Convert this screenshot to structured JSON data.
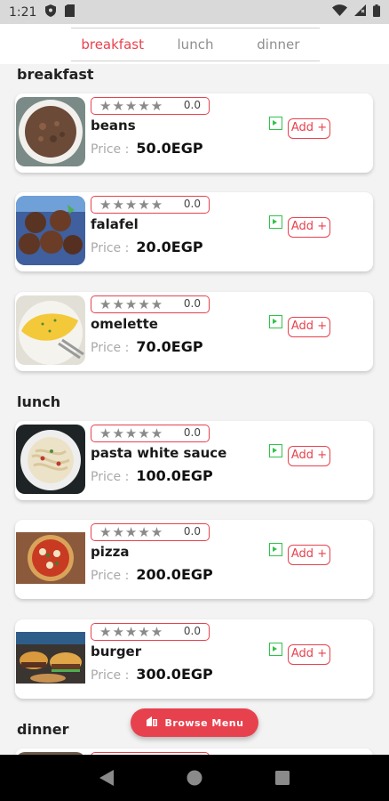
{
  "status_bar": {
    "time": "1:21"
  },
  "tabs": [
    {
      "label": "breakfast",
      "active": true
    },
    {
      "label": "lunch",
      "active": false
    },
    {
      "label": "dinner",
      "active": false
    }
  ],
  "sections": {
    "breakfast": "breakfast",
    "lunch": "lunch",
    "dinner": "dinner"
  },
  "common": {
    "price_label": "Price :",
    "add_label": "Add +",
    "stars": "★★★★★"
  },
  "items": [
    {
      "name": "beans",
      "rating": "0.0",
      "price": "50.0EGP"
    },
    {
      "name": "falafel",
      "rating": "0.0",
      "price": "20.0EGP"
    },
    {
      "name": "omelette",
      "rating": "0.0",
      "price": "70.0EGP"
    },
    {
      "name": "pasta white sauce",
      "rating": "0.0",
      "price": "100.0EGP"
    },
    {
      "name": "pizza",
      "rating": "0.0",
      "price": "200.0EGP"
    },
    {
      "name": "burger",
      "rating": "0.0",
      "price": "300.0EGP"
    }
  ],
  "fab": {
    "label": "Browse Menu"
  },
  "colors": {
    "accent": "#e8414e",
    "veg": "#2ec44a"
  }
}
